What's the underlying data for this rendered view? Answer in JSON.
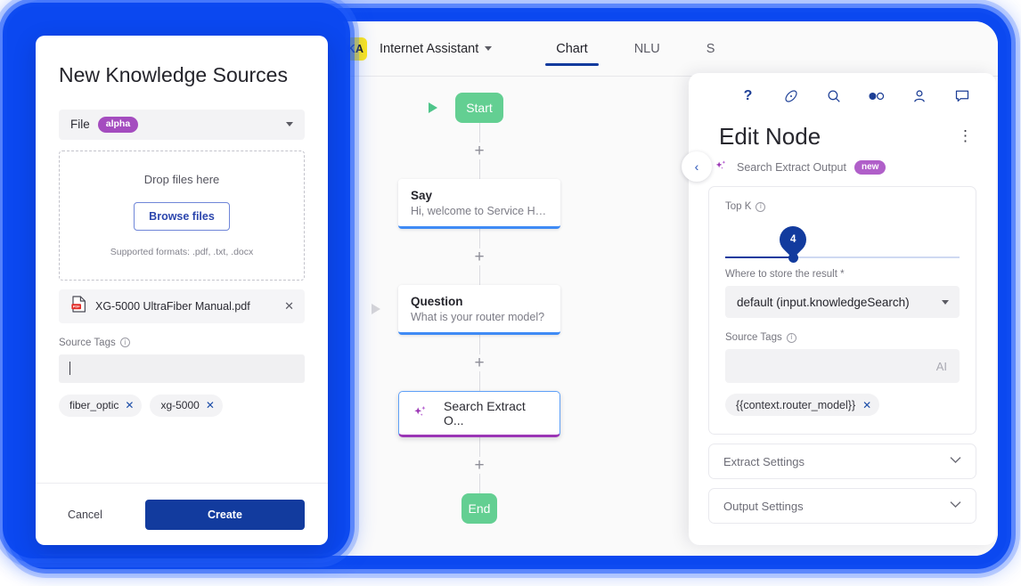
{
  "app": {
    "bot_initials": "KA",
    "bot_name": "Internet Assistant",
    "tabs": [
      {
        "label": "Chart",
        "active": true
      },
      {
        "label": "NLU",
        "active": false
      },
      {
        "label": "S",
        "active": false
      }
    ]
  },
  "flow": {
    "start_label": "Start",
    "end_label": "End",
    "plus_label": "+",
    "nodes": [
      {
        "title": "Say",
        "subtitle": "Hi, welcome to Service Help..."
      },
      {
        "title": "Question",
        "subtitle": "What is your router model?"
      }
    ],
    "selected_node": {
      "title": "Search Extract O..."
    },
    "collapse_icon": "‹"
  },
  "right_panel": {
    "icons": [
      "help-icon",
      "compass-icon",
      "search-icon",
      "toggle-icon",
      "person-icon",
      "chat-icon"
    ],
    "help_glyph": "?",
    "title": "Edit Node",
    "kebab": "⋮",
    "node_name": "Search Extract Output",
    "node_badge": "new",
    "topk": {
      "label": "Top K",
      "value": "4",
      "percent": 29
    },
    "store": {
      "label": "Where to store the result *",
      "value": "default (input.knowledgeSearch)"
    },
    "source_tags": {
      "label": "Source Tags",
      "value": "",
      "ai_hint": "AI",
      "tags": [
        {
          "label": "{{context.router_model}}",
          "remove": "✕"
        }
      ]
    },
    "accordions": [
      {
        "label": "Extract Settings",
        "chevron": "⌄"
      },
      {
        "label": "Output Settings",
        "chevron": "⌄"
      }
    ]
  },
  "dialog": {
    "title": "New Knowledge Sources",
    "source_type": {
      "label": "File",
      "badge": "alpha"
    },
    "dropzone": {
      "drop_text": "Drop files here",
      "browse_label": "Browse files",
      "formats": "Supported formats: .pdf, .txt, .docx"
    },
    "file": {
      "name": "XG-5000 UltraFiber Manual.pdf",
      "type": "PDF",
      "remove": "✕"
    },
    "source_tags": {
      "label": "Source Tags",
      "value": "",
      "tags": [
        {
          "label": "fiber_optic",
          "remove": "✕"
        },
        {
          "label": "xg-5000",
          "remove": "✕"
        }
      ]
    },
    "cancel_label": "Cancel",
    "create_label": "Create"
  },
  "colors": {
    "glow_blue": "#0b48f0",
    "primary_blue": "#123b9e",
    "node_green": "#63cf92",
    "purple": "#a44cbf",
    "yellow": "#ffe81a"
  }
}
